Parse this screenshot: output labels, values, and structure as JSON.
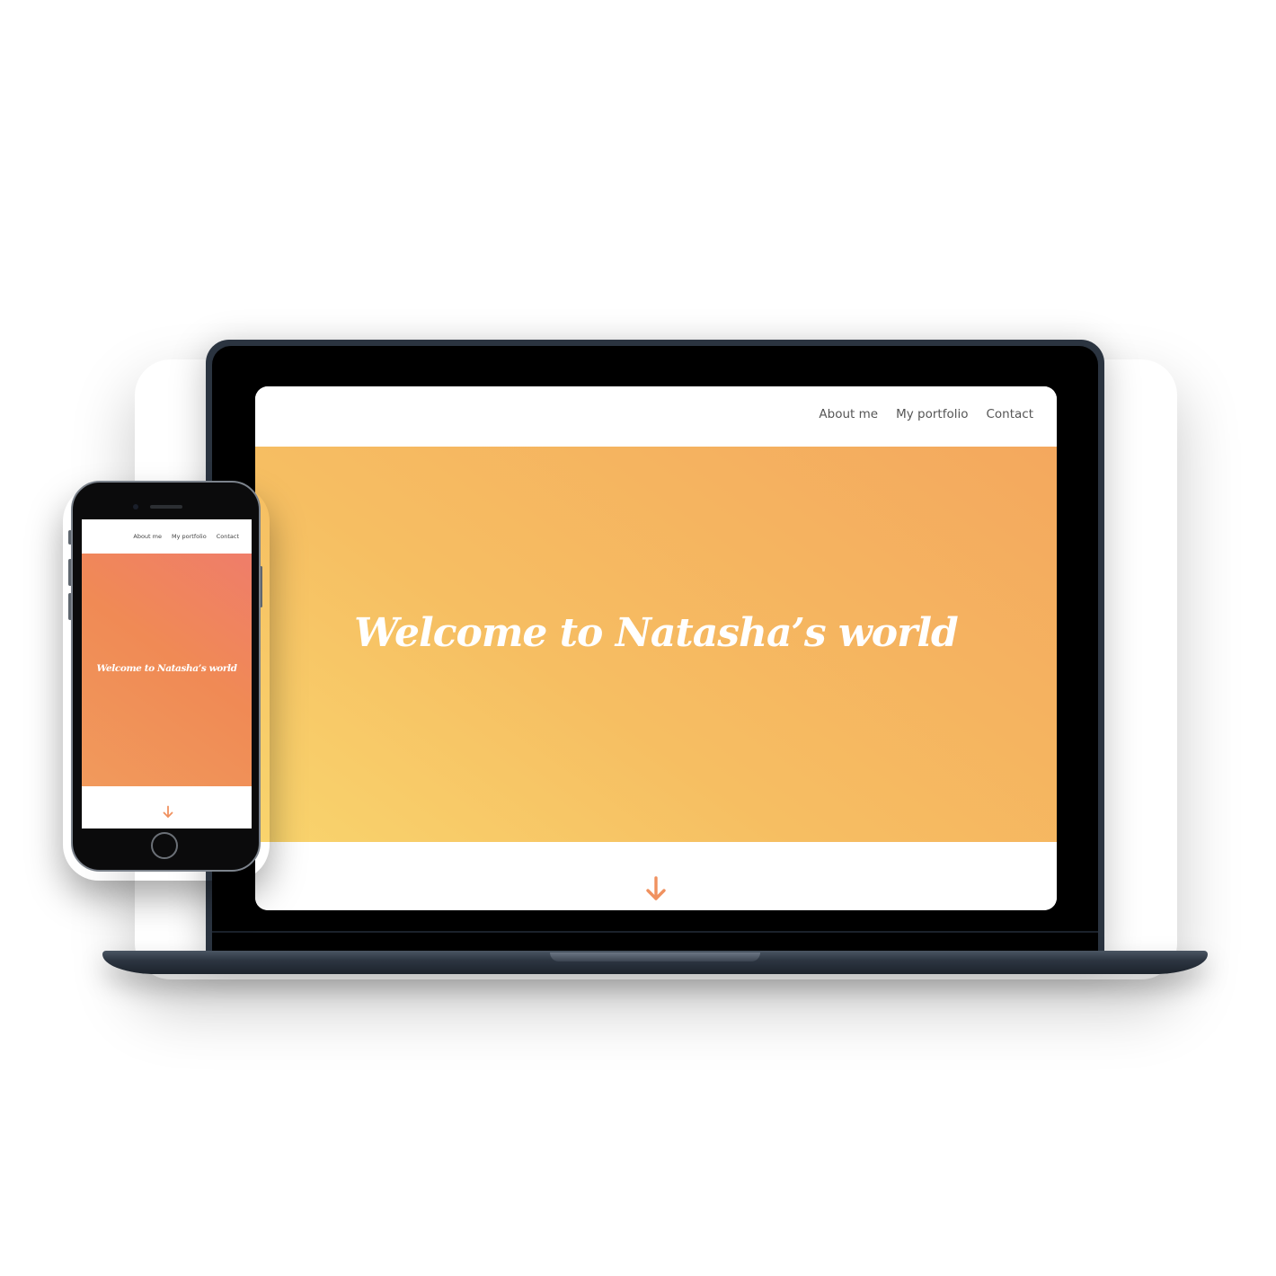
{
  "desktop": {
    "nav": {
      "about": "About me",
      "portfolio": "My portfolio",
      "contact": "Contact"
    },
    "hero": {
      "title": "Welcome to Natasha’s world",
      "gradient_colors": [
        "#f9d46d",
        "#f6be62",
        "#f4a85e"
      ]
    },
    "scroll_icon": "arrow-down-icon",
    "accent_color": "#f0915f"
  },
  "mobile": {
    "nav": {
      "about": "About me",
      "portfolio": "My portfolio",
      "contact": "Contact"
    },
    "hero": {
      "title": "Welcome to Natasha’s world",
      "gradient_colors": [
        "#ef7d6a",
        "#f08a55",
        "#f19a5c"
      ]
    },
    "scroll_icon": "arrow-down-icon",
    "accent_color": "#f0915f"
  }
}
